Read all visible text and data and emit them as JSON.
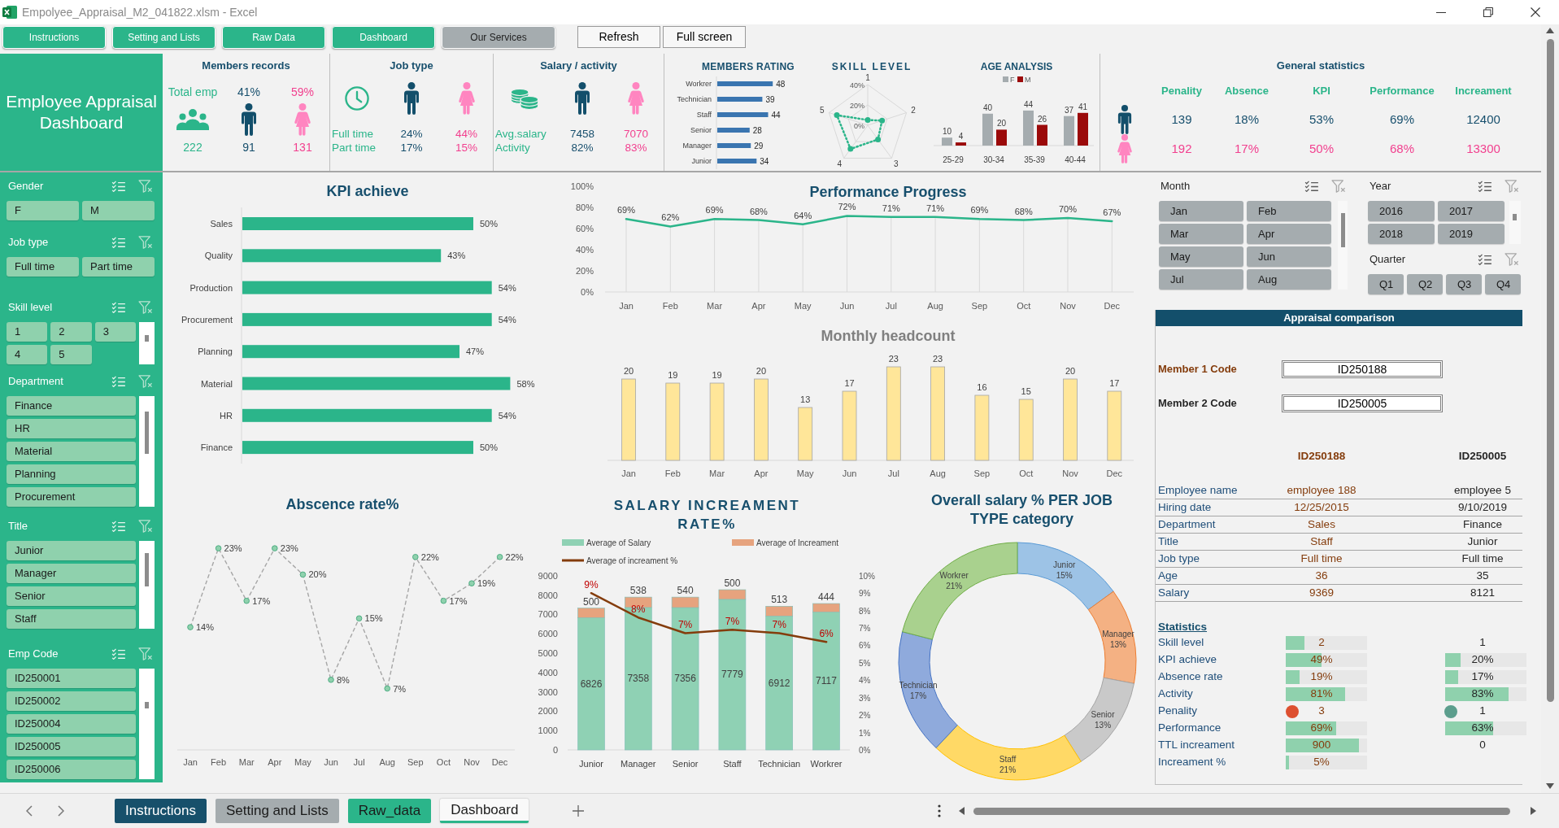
{
  "window": {
    "title": "Empolyee_Appraisal_M2_041822.xlsm - Excel"
  },
  "nav_buttons": [
    {
      "label": "Instructions",
      "color": "#2bb58a"
    },
    {
      "label": "Setting and Lists",
      "color": "#2bb58a"
    },
    {
      "label": "Raw Data",
      "color": "#2bb58a"
    },
    {
      "label": "Dashboard",
      "color": "#2bb58a"
    },
    {
      "label": "Our Services",
      "color": "#a5acaf"
    }
  ],
  "action_buttons": [
    {
      "label": "Refresh"
    },
    {
      "label": "Full screen"
    }
  ],
  "dashboard_title": "Employee Appraisal Dashboard",
  "members_records": {
    "title": "Members records",
    "total_label": "Total emp",
    "total": "222",
    "male_share": "41%",
    "male_count": "91",
    "female_share": "59%",
    "female_count": "131"
  },
  "job_type": {
    "title": "Job type",
    "rows": [
      {
        "label": "Full time",
        "male": "24%",
        "female": "44%"
      },
      {
        "label": "Part time",
        "male": "17%",
        "female": "15%"
      }
    ]
  },
  "salary_activity": {
    "title": "Salary / activity",
    "rows": [
      {
        "label": "Avg.salary",
        "male": "7458",
        "female": "7070"
      },
      {
        "label": "Activity",
        "male": "82%",
        "female": "83%"
      }
    ]
  },
  "members_rating": {
    "chart_data": {
      "type": "bar",
      "orientation": "horizontal",
      "title": "MEMBERS RATING",
      "categories": [
        "Workrer",
        "Technician",
        "Staff",
        "Senior",
        "Manager",
        "Junior"
      ],
      "values": [
        48,
        39,
        44,
        28,
        29,
        34
      ],
      "data_labels": true
    }
  },
  "skill_level": {
    "title": "SKILL LEVEL",
    "axis_labels": [
      "1",
      "2",
      "3",
      "4",
      "5"
    ],
    "scale_labels": [
      "40%",
      "20%",
      "0%"
    ]
  },
  "age_analysis": {
    "chart_data": {
      "type": "bar",
      "title": "AGE ANALYSIS",
      "legend": "top",
      "categories": [
        "25-29",
        "30-34",
        "35-39",
        "40-44"
      ],
      "series": [
        {
          "name": "F",
          "color": "#a5acaf",
          "values": [
            10,
            40,
            44,
            37
          ]
        },
        {
          "name": "M",
          "color": "#9b0a0a",
          "values": [
            4,
            20,
            26,
            41
          ]
        }
      ],
      "data_labels": true
    }
  },
  "general_statistics": {
    "title": "General statistics",
    "columns": [
      "Penality",
      "Absence",
      "KPI",
      "Performance",
      "Increament"
    ],
    "rows": [
      {
        "kind": "male",
        "values": [
          "139",
          "18%",
          "53%",
          "69%",
          "12400"
        ]
      },
      {
        "kind": "female",
        "values": [
          "192",
          "17%",
          "50%",
          "68%",
          "13300"
        ]
      }
    ]
  },
  "filters": [
    {
      "title": "Gender",
      "items": [
        {
          "label": "F",
          "selected": true
        },
        {
          "label": "M",
          "selected": true
        }
      ]
    },
    {
      "title": "Job type",
      "items": [
        {
          "label": "Full time",
          "selected": true
        },
        {
          "label": "Part time",
          "selected": true
        }
      ]
    },
    {
      "title": "Skill level",
      "items": [
        {
          "label": "1",
          "selected": true
        },
        {
          "label": "2",
          "selected": true
        },
        {
          "label": "3",
          "selected": true
        },
        {
          "label": "4",
          "selected": true
        },
        {
          "label": "5",
          "selected": true
        }
      ]
    },
    {
      "title": "Department",
      "items": [
        {
          "label": "Finance",
          "selected": true
        },
        {
          "label": "HR",
          "selected": true
        },
        {
          "label": "Material",
          "selected": true
        },
        {
          "label": "Planning",
          "selected": true
        },
        {
          "label": "Procurement",
          "selected": true
        }
      ]
    },
    {
      "title": "Title",
      "items": [
        {
          "label": "Junior",
          "selected": true
        },
        {
          "label": "Manager",
          "selected": true
        },
        {
          "label": "Senior",
          "selected": true
        },
        {
          "label": "Staff",
          "selected": true
        }
      ]
    },
    {
      "title": "Emp Code",
      "items": [
        {
          "label": "ID250001",
          "selected": true
        },
        {
          "label": "ID250002",
          "selected": true
        },
        {
          "label": "ID250004",
          "selected": true
        },
        {
          "label": "ID250005",
          "selected": true
        },
        {
          "label": "ID250006",
          "selected": true
        }
      ]
    }
  ],
  "kpi_achieve": {
    "chart_data": {
      "type": "bar",
      "orientation": "horizontal",
      "title": "KPI achieve",
      "categories": [
        "Sales",
        "Quality",
        "Production",
        "Procurement",
        "Planning",
        "Material",
        "HR",
        "Finance"
      ],
      "values": [
        50,
        43,
        54,
        54,
        47,
        58,
        54,
        50
      ],
      "value_labels": [
        "50%",
        "43%",
        "54%",
        "54%",
        "47%",
        "58%",
        "54%",
        "50%"
      ]
    }
  },
  "performance_progress": {
    "chart_data": {
      "type": "line",
      "title": "Performance Progress",
      "grid": true,
      "categories": [
        "Jan",
        "Feb",
        "Mar",
        "Apr",
        "May",
        "Jun",
        "Jul",
        "Aug",
        "Sep",
        "Oct",
        "Nov",
        "Dec"
      ],
      "values": [
        69,
        62,
        69,
        68,
        64,
        72,
        71,
        71,
        69,
        68,
        70,
        67
      ],
      "value_labels": [
        "69%",
        "62%",
        "69%",
        "68%",
        "64%",
        "72%",
        "71%",
        "71%",
        "69%",
        "68%",
        "70%",
        "67%"
      ],
      "ylim": [
        0,
        100
      ],
      "yticks": [
        {
          "value": 0,
          "label": "0%"
        },
        {
          "value": 20,
          "label": "20%"
        },
        {
          "value": 40,
          "label": "40%"
        },
        {
          "value": 60,
          "label": "60%"
        },
        {
          "value": 80,
          "label": "80%"
        },
        {
          "value": 100,
          "label": "100%"
        }
      ]
    }
  },
  "monthly_headcount": {
    "chart_data": {
      "type": "bar",
      "title": "Monthly headcount",
      "categories": [
        "Jan",
        "Feb",
        "Mar",
        "Apr",
        "May",
        "Jun",
        "Jul",
        "Aug",
        "Sep",
        "Oct",
        "Nov",
        "Dec"
      ],
      "values": [
        20,
        19,
        19,
        20,
        13,
        17,
        23,
        23,
        16,
        15,
        20,
        17
      ],
      "data_labels": true
    }
  },
  "absence_rate": {
    "chart_data": {
      "type": "line",
      "title": "Abscence rate%",
      "line_style": "dashed",
      "marker": "circle",
      "categories": [
        "Jan",
        "Feb",
        "Mar",
        "Apr",
        "May",
        "Jun",
        "Jul",
        "Aug",
        "Sep",
        "Oct",
        "Nov",
        "Dec"
      ],
      "values": [
        14,
        23,
        17,
        23,
        20,
        8,
        15,
        7,
        22,
        17,
        19,
        22
      ],
      "value_labels": [
        "14%",
        "23%",
        "17%",
        "23%",
        "20%",
        "8%",
        "15%",
        "7%",
        "22%",
        "17%",
        "19%",
        "22%"
      ]
    }
  },
  "salary_increament": {
    "chart_data": {
      "type": "bar",
      "stacked": true,
      "title": "SALARY INCREAMENT RATE%",
      "legend": "top",
      "categories": [
        "Junior",
        "Manager",
        "Senior",
        "Staff",
        "Technician",
        "Workrer"
      ],
      "series": [
        {
          "name": "Average of Salary",
          "color": "#8fd1b4",
          "values": [
            6826,
            7358,
            7356,
            7779,
            6912,
            7117
          ]
        },
        {
          "name": "Average of Increament",
          "color": "#e6a37e",
          "values": [
            500,
            538,
            540,
            500,
            513,
            444
          ]
        }
      ],
      "data_labels": true,
      "ylim": [
        0,
        9000
      ],
      "yticks": [
        0,
        1000,
        2000,
        3000,
        4000,
        5000,
        6000,
        7000,
        8000,
        9000
      ]
    },
    "increament_rate": {
      "chart_data": {
        "type": "line",
        "legend": "top",
        "categories": [
          null,
          null,
          null,
          null,
          null,
          null
        ],
        "series": [
          {
            "name": "Average of increament %",
            "color": "#843c0c",
            "values": [
              9,
              7.6,
              6.7,
              6.9,
              6.7,
              6.2
            ],
            "value_labels": [
              "9%",
              "8%",
              "7%",
              "7%",
              "7%",
              "6%"
            ]
          }
        ],
        "ylim": [
          0,
          10
        ],
        "yticks": [
          {
            "value": 0,
            "label": "0%"
          },
          {
            "value": 1,
            "label": "1%"
          },
          {
            "value": 2,
            "label": "2%"
          },
          {
            "value": 3,
            "label": "3%"
          },
          {
            "value": 4,
            "label": "4%"
          },
          {
            "value": 5,
            "label": "5%"
          },
          {
            "value": 6,
            "label": "6%"
          },
          {
            "value": 7,
            "label": "7%"
          },
          {
            "value": 8,
            "label": "8%"
          },
          {
            "value": 9,
            "label": "9%"
          },
          {
            "value": 10,
            "label": "10%"
          }
        ]
      }
    }
  },
  "salary_share": {
    "chart_data": {
      "type": "donut",
      "title": "Overall salary % PER JOB TYPE category",
      "categories": [
        "Junior",
        "Manager",
        "Senior",
        "Staff",
        "Technician",
        "Workrer"
      ],
      "values": [
        15,
        13,
        13,
        21,
        17,
        21
      ],
      "value_labels": [
        "15%",
        "13%",
        "13%",
        "21%",
        "17%",
        "21%"
      ],
      "data_labels": true
    }
  },
  "period_filters": [
    {
      "title": "Month",
      "items": [
        {
          "label": "Jan",
          "selected": true
        },
        {
          "label": "Feb",
          "selected": true
        },
        {
          "label": "Mar",
          "selected": true
        },
        {
          "label": "Apr",
          "selected": true
        },
        {
          "label": "May",
          "selected": true
        },
        {
          "label": "Jun",
          "selected": true
        },
        {
          "label": "Jul",
          "selected": true
        },
        {
          "label": "Aug",
          "selected": true
        }
      ]
    },
    {
      "title": "Year",
      "items": [
        {
          "label": "2016",
          "selected": true
        },
        {
          "label": "2017",
          "selected": true
        },
        {
          "label": "2018",
          "selected": true
        },
        {
          "label": "2019",
          "selected": true
        }
      ]
    },
    {
      "title": "Quarter",
      "items": [
        {
          "label": "Q1",
          "selected": true
        },
        {
          "label": "Q2",
          "selected": true
        },
        {
          "label": "Q3",
          "selected": true
        },
        {
          "label": "Q4",
          "selected": true
        }
      ]
    }
  ],
  "appraisal_comparison": {
    "title": "Appraisal comparison",
    "member_codes": [
      {
        "label": "Member 1 Code",
        "value": "ID250188"
      },
      {
        "label": "Member 2 Code",
        "value": "ID250005"
      }
    ],
    "columns": [
      "ID250188",
      "ID250005"
    ],
    "details": [
      {
        "label": "Employee name",
        "values": [
          "employee 188",
          "employee 5"
        ]
      },
      {
        "label": "Hiring date",
        "values": [
          "12/25/2015",
          "9/10/2019"
        ]
      },
      {
        "label": "Department",
        "values": [
          "Sales",
          "Finance"
        ]
      },
      {
        "label": "Title",
        "values": [
          "Staff",
          "Junior"
        ]
      },
      {
        "label": "Job type",
        "values": [
          "Full time",
          "Full time"
        ]
      },
      {
        "label": "Age",
        "values": [
          "36",
          "35"
        ]
      },
      {
        "label": "Salary",
        "values": [
          "9369",
          "8121"
        ]
      }
    ],
    "statistics_title": "Statistics",
    "statistics": [
      {
        "label": "Skill level",
        "member_1": {
          "value": "2",
          "level": 0.23
        },
        "member_2": {
          "value": "1"
        }
      },
      {
        "label": "KPI achieve",
        "member_1": {
          "value": "49%",
          "level": 0.44
        },
        "member_2": {
          "value": "20%",
          "level": 0.19
        }
      },
      {
        "label": "Absence rate",
        "member_1": {
          "value": "19%",
          "level": 0.17
        },
        "member_2": {
          "value": "17%",
          "level": 0.16
        }
      },
      {
        "label": "Activity",
        "member_1": {
          "value": "81%",
          "level": 0.73
        },
        "member_2": {
          "value": "83%",
          "level": 0.78
        }
      },
      {
        "label": "Penality",
        "member_1": {
          "value": "3",
          "color": "#dd5030"
        },
        "member_2": {
          "value": "1",
          "color": "#5c9e8d"
        }
      },
      {
        "label": "Performance",
        "member_1": {
          "value": "69%",
          "level": 0.62
        },
        "member_2": {
          "value": "63%",
          "level": 0.59
        }
      },
      {
        "label": "TTL increament",
        "member_1": {
          "value": "900",
          "level": 0.9
        },
        "member_2": {
          "value": "0"
        }
      },
      {
        "label": "Increament %",
        "member_1": {
          "value": "5%",
          "level": 0.04
        }
      }
    ]
  },
  "sheet_tabs": [
    {
      "label": "Instructions",
      "color": "#17506b",
      "selected": false
    },
    {
      "label": "Setting and Lists",
      "color": "#a5acaf",
      "selected": false
    },
    {
      "label": "Raw_data",
      "color": "#2bb58a",
      "selected": false
    },
    {
      "label": "Dashboard",
      "color": "#2bb58a",
      "selected": true
    }
  ]
}
